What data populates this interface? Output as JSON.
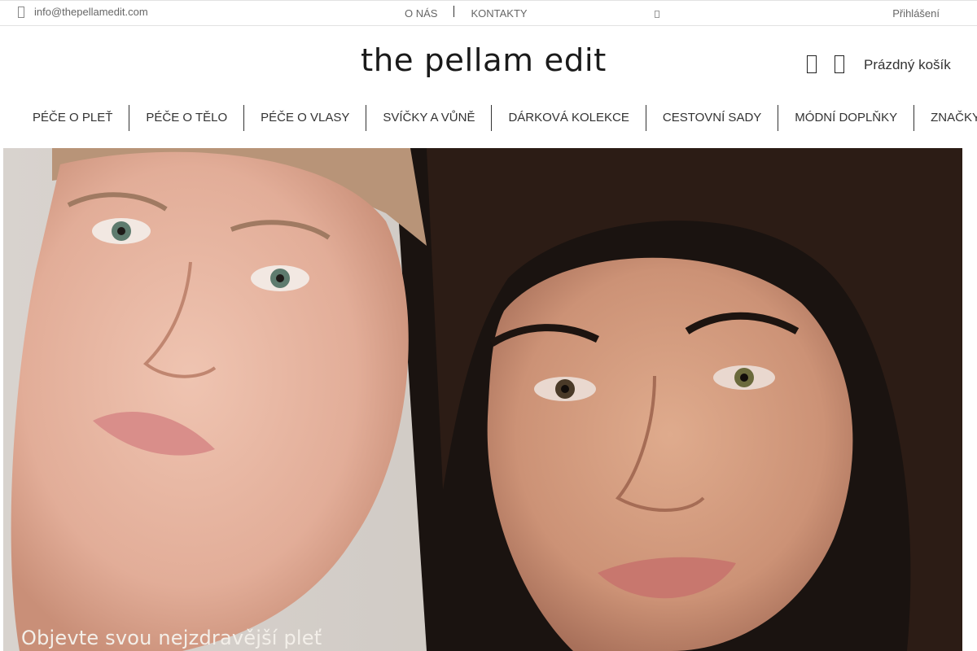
{
  "topbar": {
    "email": "info@thepellamedit.com",
    "email_icon": "envelope-icon",
    "nav": [
      "O NÁS",
      "KONTAKTY"
    ],
    "login": "Přihlášení"
  },
  "header": {
    "logo": "the pellam edit",
    "icons": [
      "search-icon",
      "account-icon"
    ],
    "cart_label": "Prázdný košík"
  },
  "main_nav": [
    "PÉČE O PLEŤ",
    "PÉČE O TĚLO",
    "PÉČE O VLASY",
    "SVÍČKY A VŮNĚ",
    "DÁRKOVÁ KOLEKCE",
    "CESTOVNÍ SADY",
    "MÓDNÍ DOPLŇKY",
    "ZNAČKY"
  ],
  "hero": {
    "caption": "Objevte svou nejzdravější pleť",
    "colors": {
      "left_bg": "#dcd6d1",
      "right_bg": "#17110e",
      "skin_light": "#e9b9a6",
      "skin_warm": "#cf9a80",
      "hair_dark": "#2a1a14"
    }
  }
}
